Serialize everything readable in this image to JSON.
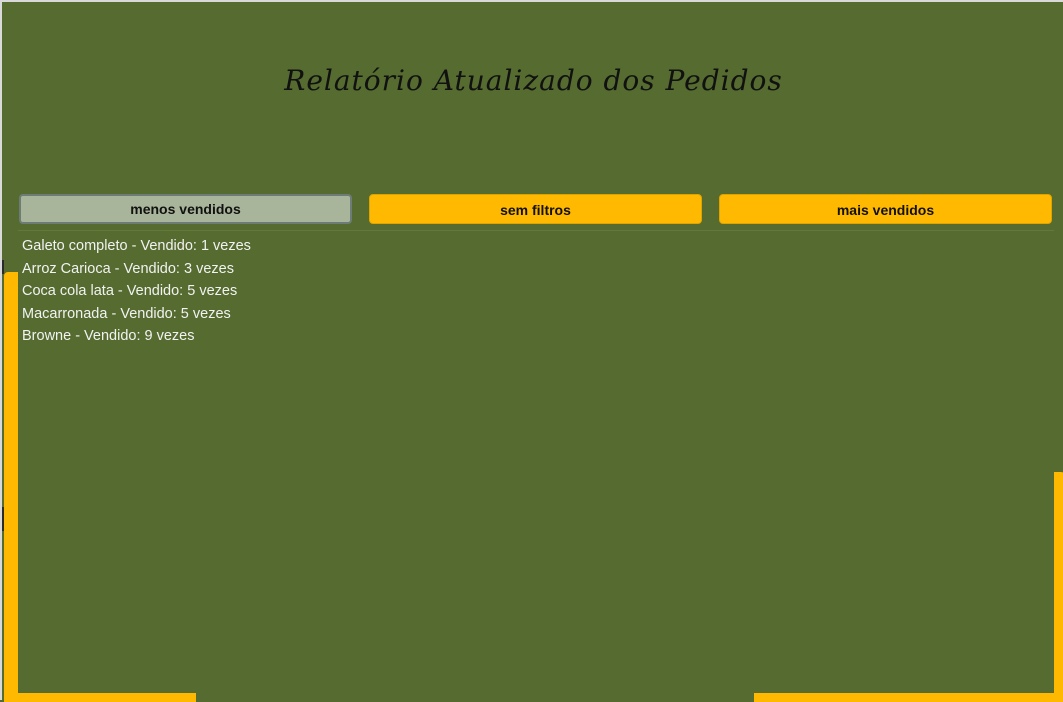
{
  "header": {
    "title": "Relatório Atualizado dos Pedidos"
  },
  "filters": {
    "less_sold": "menos vendidos",
    "no_filter": "sem filtros",
    "most_sold": "mais vendidos",
    "selected": "menos vendidos"
  },
  "orders": {
    "items": [
      "Galeto completo - Vendido: 1 vezes",
      "Arroz Carioca - Vendido: 3 vezes",
      "Coca cola lata - Vendido: 5 vezes",
      "Macarronada - Vendido: 5 vezes",
      "Browne - Vendido: 9 vezes"
    ]
  },
  "colors": {
    "background": "#556b2f",
    "accent": "#ffb900",
    "selected_button": "#a8b59a",
    "list_text": "#f2f2f2",
    "title_text": "#111111"
  }
}
